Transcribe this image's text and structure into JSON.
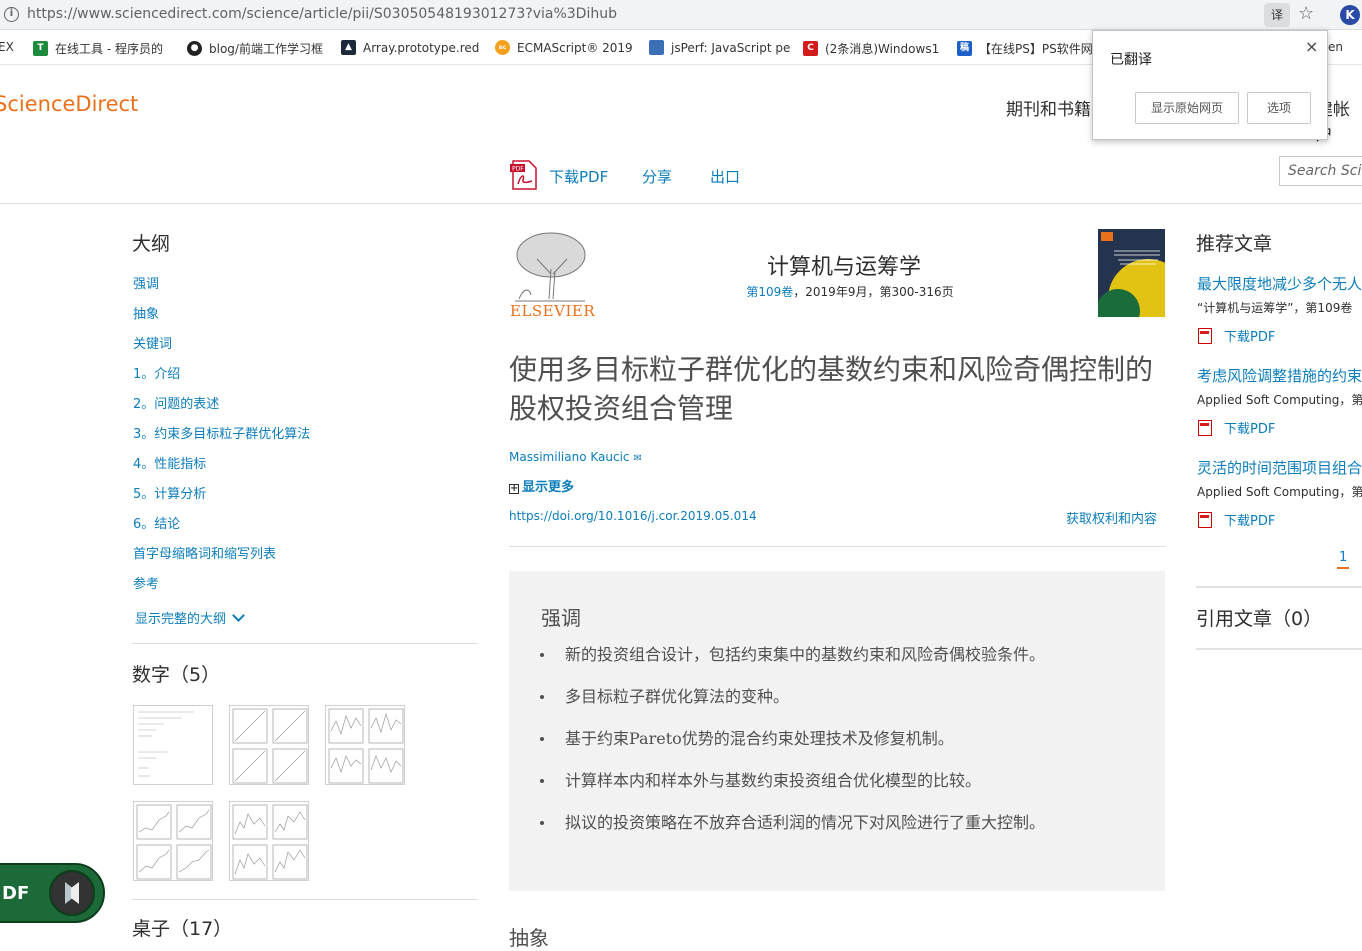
{
  "browser": {
    "url": "https://www.sciencedirect.com/science/article/pii/S0305054819301273?via%3Dihub",
    "bookmarks": [
      {
        "label": "EX"
      },
      {
        "label": "在线工具 - 程序员的"
      },
      {
        "label": "blog/前端工作学习框"
      },
      {
        "label": "Array.prototype.red"
      },
      {
        "label": "ECMAScript® 2019"
      },
      {
        "label": "jsPerf: JavaScript pe"
      },
      {
        "label": "(2条消息)Windows1"
      },
      {
        "label": "【在线PS】PS软件网"
      },
      {
        "label": "en"
      }
    ]
  },
  "translate_popup": {
    "title": "已翻译",
    "show_original": "显示原始网页",
    "options": "选项",
    "close": "×"
  },
  "header": {
    "logo": "ScienceDirect",
    "nav_journals": "期刊和书籍",
    "nav_account": "建帐户"
  },
  "toolbar": {
    "download_pdf": "下载PDF",
    "share": "分享",
    "export": "出口",
    "search_placeholder": "Search ScienceDirect"
  },
  "outline": {
    "title": "大纲",
    "items": [
      "强调",
      "抽象",
      "关键词",
      "1。介绍",
      "2。问题的表述",
      "3。约束多目标粒子群优化算法",
      "4。性能指标",
      "5。计算分析",
      "6。结论",
      "首字母缩略词和缩写列表",
      "参考"
    ],
    "show_full": "显示完整的大纲"
  },
  "figures": {
    "title": "数字（5）"
  },
  "tables": {
    "title": "桌子（17）"
  },
  "float_pdf": {
    "label": "DF"
  },
  "article": {
    "publisher": "ELSEVIER",
    "journal": "计算机与运筹学",
    "volume_link": "第109卷",
    "volume_rest": "，2019年9月，第300-316页",
    "title": "使用多目标粒子群优化的基数约束和风险奇偶控制的股权投资组合管理",
    "author": "Massimiliano Kaucic",
    "show_more": "显示更多",
    "doi": "https://doi.org/10.1016/j.cor.2019.05.014",
    "rights": "获取权利和内容"
  },
  "highlights": {
    "title": "强调",
    "items": [
      "新的投资组合设计，包括约束集中的基数约束和风险奇偶校验条件。",
      "多目标粒子群优化算法的变种。",
      "基于约束Pareto优势的混合约束处理技术及修复机制。",
      "计算样本内和样本外与基数约束投资组合优化模型的比较。",
      "拟议的投资策略在不放弃合适利润的情况下对风险进行了重大控制。"
    ]
  },
  "abstract": {
    "title": "抽象"
  },
  "recommended": {
    "title": "推荐文章",
    "items": [
      {
        "title": "最大限度地减少多个无人",
        "source": "“计算机与运筹学”，第109卷",
        "pdf": "下载PDF"
      },
      {
        "title": "考虑风险调整措施的约束",
        "source": "Applied Soft Computing，第",
        "pdf": "下载PDF"
      },
      {
        "title": "灵活的时间范围项目组合",
        "source": "Applied Soft Computing，第",
        "pdf": "下载PDF"
      }
    ],
    "page": "1"
  },
  "cited": {
    "title": "引用文章（0）"
  }
}
